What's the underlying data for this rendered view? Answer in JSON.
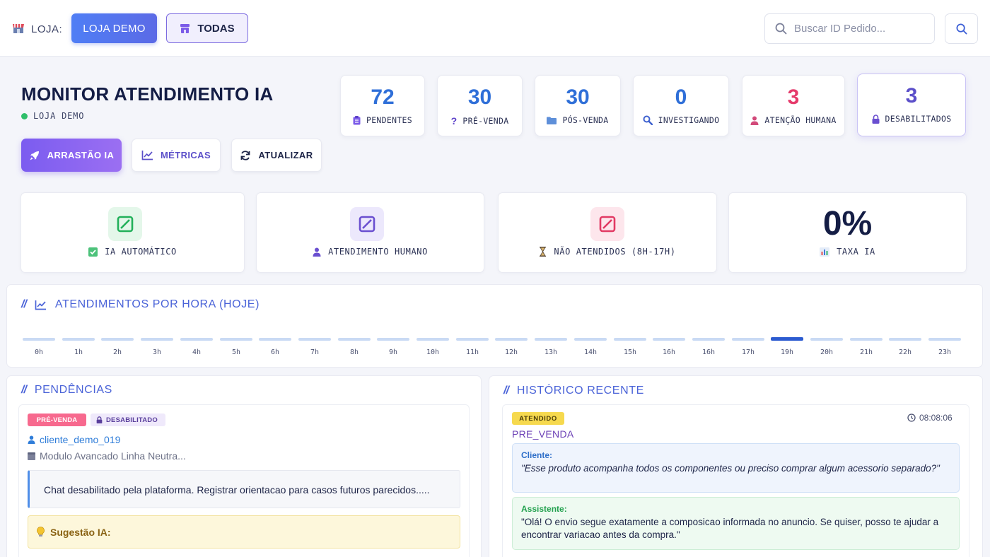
{
  "topbar": {
    "store_label": "LOJA:",
    "store_active_button": "LOJA DEMO",
    "store_all_button": "TODAS",
    "search_placeholder": "Buscar ID Pedido..."
  },
  "header": {
    "title": "MONITOR ATENDIMENTO IA",
    "store_name": "LOJA DEMO",
    "actions": {
      "arrastao": "ARRASTÃO IA",
      "metricas": "MÉTRICAS",
      "atualizar": "ATUALIZAR"
    }
  },
  "stats": [
    {
      "value": "72",
      "label": "PENDENTES",
      "color": "#2f6fd8"
    },
    {
      "value": "30",
      "label": "PRÉ-VENDA",
      "color": "#2f6fd8"
    },
    {
      "value": "30",
      "label": "PÓS-VENDA",
      "color": "#2f6fd8"
    },
    {
      "value": "0",
      "label": "INVESTIGANDO",
      "color": "#2f6fd8"
    },
    {
      "value": "3",
      "label": "ATENÇÃO HUMANA",
      "color": "#e53a6b"
    },
    {
      "value": "3",
      "label": "DESABILITADOS",
      "color": "#5b4fc9"
    }
  ],
  "kpis": {
    "ia_auto": "IA AUTOMÁTICO",
    "humano": "ATENDIMENTO HUMANO",
    "nao_atendidos": "NÃO ATENDIDOS (8H-17H)",
    "taxa_value": "0%",
    "taxa_label": "TAXA IA"
  },
  "hourly": {
    "title": "ATENDIMENTOS POR HORA (HOJE)",
    "hours": [
      "0h",
      "1h",
      "2h",
      "3h",
      "4h",
      "5h",
      "6h",
      "7h",
      "8h",
      "9h",
      "10h",
      "11h",
      "12h",
      "13h",
      "14h",
      "15h",
      "16h",
      "16h",
      "17h",
      "19h",
      "20h",
      "21h",
      "22h",
      "23h"
    ],
    "active_hour": "19h"
  },
  "pendencias": {
    "title": "PENDÊNCIAS",
    "tag_type": "PRÉ-VENDA",
    "tag_status": "DESABILITADO",
    "client": "cliente_demo_019",
    "product": "Modulo Avancado Linha Neutra...",
    "chat_message": "Chat desabilitado pela plataforma. Registrar orientacao para casos futuros parecidos.....",
    "suggestion_label": "Sugestão IA:"
  },
  "historico": {
    "title": "HISTÓRICO RECENTE",
    "status": "ATENDIDO",
    "time": "08:08:06",
    "type": "PRE_VENDA",
    "client_label": "Cliente:",
    "client_msg": "\"Esse produto acompanha todos os componentes ou preciso comprar algum acessorio separado?\"",
    "assistant_label": "Assistente:",
    "assistant_msg": "\"Olá! O envio segue exatamente a composicao informada no anuncio. Se quiser, posso te ajudar a encontrar variacao antes da compra.\""
  }
}
